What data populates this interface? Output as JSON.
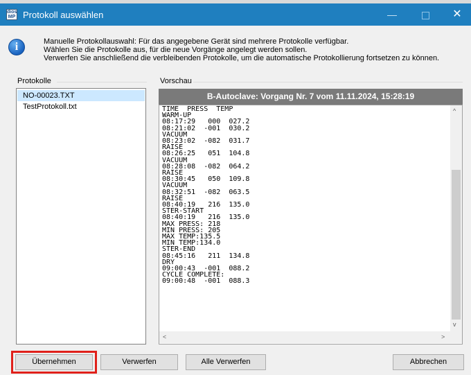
{
  "window": {
    "title": "Protokoll auswählen",
    "app_icon_text": [
      "dios",
      "MP"
    ],
    "minimize_glyph": "—",
    "close_glyph": "✕"
  },
  "info": {
    "icon_glyph": "i",
    "lines": [
      "Manuelle Protokollauswahl: Für das angegebene Gerät sind mehrere Protokolle verfügbar.",
      "Wählen Sie die Protokolle aus, für die neue Vorgänge angelegt werden sollen.",
      "Verwerfen Sie anschließend die verbleibenden Protokolle, um die automatische Protokollierung fortsetzen zu können."
    ]
  },
  "protocols": {
    "label": "Protokolle",
    "items": [
      "NO-00023.TXT",
      "TestProtokoll.txt"
    ],
    "selected_index": 0
  },
  "preview": {
    "label": "Vorschau",
    "header": "B-Autoclave: Vorgang Nr. 7 vom 11.11.2024, 15:28:19",
    "text": "TIME  PRESS  TEMP\nWARM-UP\n08:17:29   000  027.2\n08:21:02  -001  030.2\nVACUUM\n08:23:02  -082  031.7\nRAISE\n08:26:25   051  104.8\nVACUUM\n08:28:08  -082  064.2\nRAISE\n08:30:45   050  109.8\nVACUUM\n08:32:51  -082  063.5\nRAISE\n08:40:19   216  135.0\nSTER-START\n08:40:19   216  135.0\nMAX PRESS: 218\nMIN PRESS: 205\nMAX TEMP:135.5\nMIN TEMP:134.0\nSTER-END\n08:45:16   211  134.8\nDRY\n09:00:43  -001  088.2\nCYCLE COMPLETE:\n09:00:48  -001  088.3",
    "scroll_up_glyph": "^",
    "scroll_down_glyph": "v",
    "scroll_left_glyph": "<",
    "scroll_right_glyph": ">"
  },
  "buttons": {
    "apply": "Übernehmen",
    "discard": "Verwerfen",
    "discard_all": "Alle Verwerfen",
    "cancel": "Abbrechen"
  },
  "colors": {
    "titlebar": "#1f7fbf",
    "highlight": "#e0201a",
    "selected_item": "#cce8ff"
  }
}
